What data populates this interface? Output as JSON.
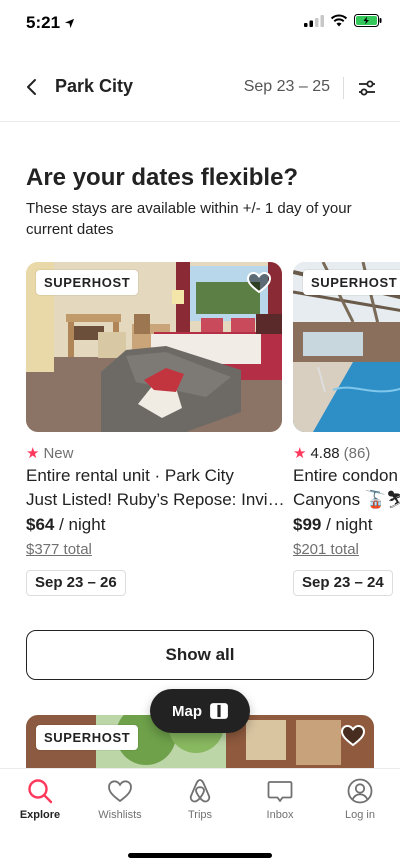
{
  "status": {
    "time": "5:21"
  },
  "header": {
    "title": "Park City",
    "dates": "Sep 23 – 25"
  },
  "flexible": {
    "title": "Are your dates flexible?",
    "subtitle": "These stays are available within +/- 1 day of your current dates"
  },
  "listings": [
    {
      "badge": "SUPERHOST",
      "rating_text": "New",
      "line1": "Entire rental unit · Park City",
      "line2": "Just Listed! Ruby’s Repose: Invi…",
      "price": "$64",
      "price_unit": "/ night",
      "total": "$377 total",
      "dates": "Sep 23 – 26"
    },
    {
      "badge": "SUPERHOST",
      "rating_score": "4.88",
      "rating_count": "(86)",
      "line1": "Entire condon",
      "line2": "Canyons 🚡⛷",
      "price": "$99",
      "price_unit": "/ night",
      "total": "$201 total",
      "dates": "Sep 23 – 24"
    },
    {
      "badge": "SUPERHOST"
    }
  ],
  "show_all_label": "Show all",
  "map_label": "Map",
  "tabs": [
    {
      "label": "Explore",
      "icon": "search-icon",
      "active": true
    },
    {
      "label": "Wishlists",
      "icon": "heart-icon"
    },
    {
      "label": "Trips",
      "icon": "airbnb-logo-icon"
    },
    {
      "label": "Inbox",
      "icon": "message-icon"
    },
    {
      "label": "Log in",
      "icon": "profile-icon"
    }
  ],
  "colors": {
    "accent": "#ff385c",
    "text": "#222222",
    "muted": "#717171",
    "battery": "#34c759"
  }
}
